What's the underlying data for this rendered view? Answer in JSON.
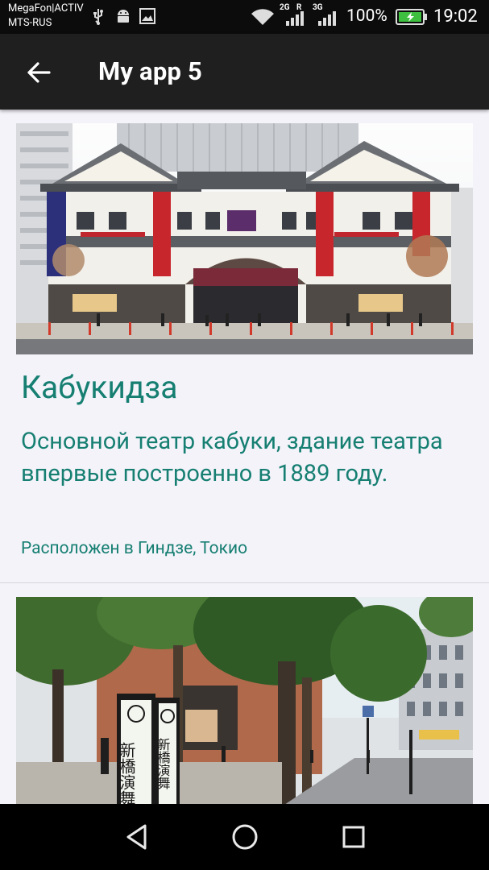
{
  "status_bar": {
    "carrier_line1": "MegaFon|ACTIV",
    "carrier_line2": "MTS-RUS",
    "net_2g": "2G",
    "net_r": "R",
    "net_3g": "3G",
    "battery_percent": "100%",
    "time": "19:02",
    "icons": [
      "usb-icon",
      "android-icon",
      "image-icon",
      "wifi-icon",
      "signal-icon",
      "battery-charging-icon"
    ]
  },
  "app_bar": {
    "title": "My app 5",
    "back_icon": "arrow-back-icon"
  },
  "cards": [
    {
      "title": "Кабукидза",
      "description": "Основной театр кабуки, здание театра впервые построенно в 1889 году.",
      "location": "Расположен в Гиндзе, Токио"
    },
    {
      "image_signs": [
        "新橋演舞",
        "新橋演舞"
      ]
    }
  ],
  "nav_bar": {
    "buttons": [
      "back-triangle-icon",
      "home-circle-icon",
      "recents-square-icon"
    ]
  },
  "colors": {
    "accent_text": "#167f72",
    "app_bar": "#1f1f1f",
    "background": "#f4f3fa"
  }
}
